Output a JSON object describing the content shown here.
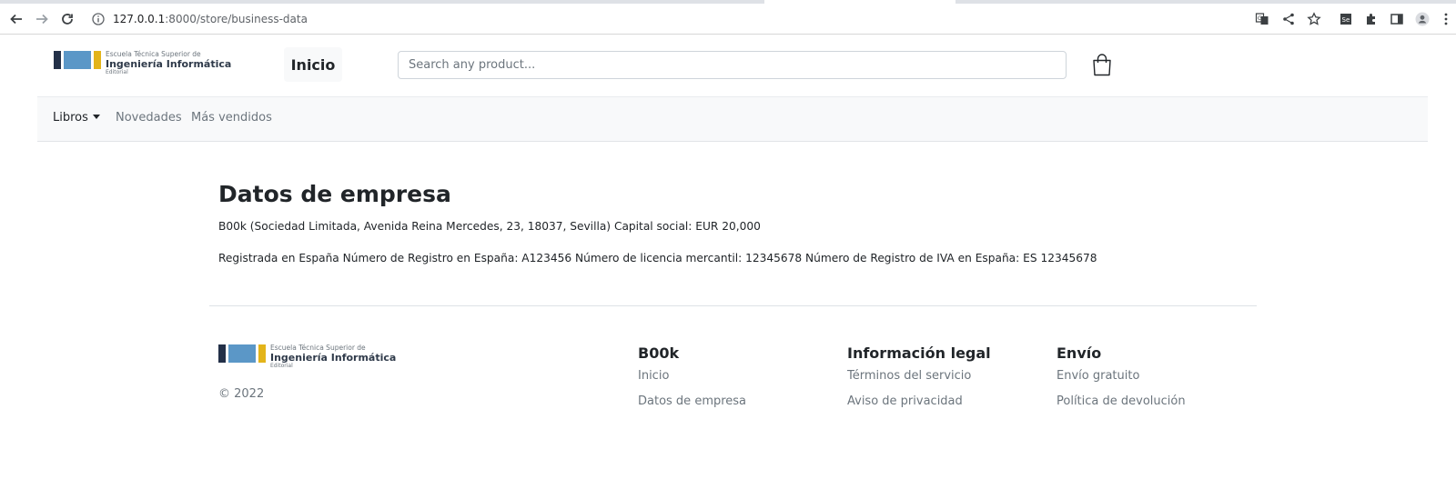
{
  "browser": {
    "url_host": "127.0.0.1",
    "url_rest": ":8000/store/business-data",
    "icons": [
      "back-arrow-icon",
      "forward-arrow-icon",
      "reload-icon",
      "info-icon",
      "translate-icon",
      "share-icon",
      "star-icon",
      "selenium-extension-icon",
      "puzzle-icon",
      "sidebar-icon",
      "profile-icon",
      "kebab-menu-icon"
    ]
  },
  "logo": {
    "line1": "Escuela Técnica Superior de",
    "line2": "Ingeniería Informática",
    "line3": "Editorial",
    "colors": {
      "dark": "#233048",
      "blue": "#5b97c7",
      "yellow": "#e3b41a"
    }
  },
  "header": {
    "home_label": "Inicio",
    "search_placeholder": "Search any product...",
    "cart_icon": "shopping-bag-icon"
  },
  "nav": {
    "items": [
      "Libros",
      "Novedades",
      "Más vendidos"
    ]
  },
  "main": {
    "title": "Datos de empresa",
    "paragraph1": "B00k (Sociedad Limitada, Avenida Reina Mercedes, 23, 18037, Sevilla) Capital social: EUR 20,000",
    "paragraph2": "Registrada en España Número de Registro en España: A123456 Número de licencia mercantil: 12345678 Número de Registro de IVA en España: ES 12345678"
  },
  "footer": {
    "copyright": "© 2022",
    "columns": [
      {
        "title": "B00k",
        "links": [
          "Inicio",
          "Datos de empresa"
        ]
      },
      {
        "title": "Información legal",
        "links": [
          "Términos del servicio",
          "Aviso de privacidad"
        ]
      },
      {
        "title": "Envío",
        "links": [
          "Envío gratuito",
          "Política de devolución"
        ]
      }
    ]
  }
}
